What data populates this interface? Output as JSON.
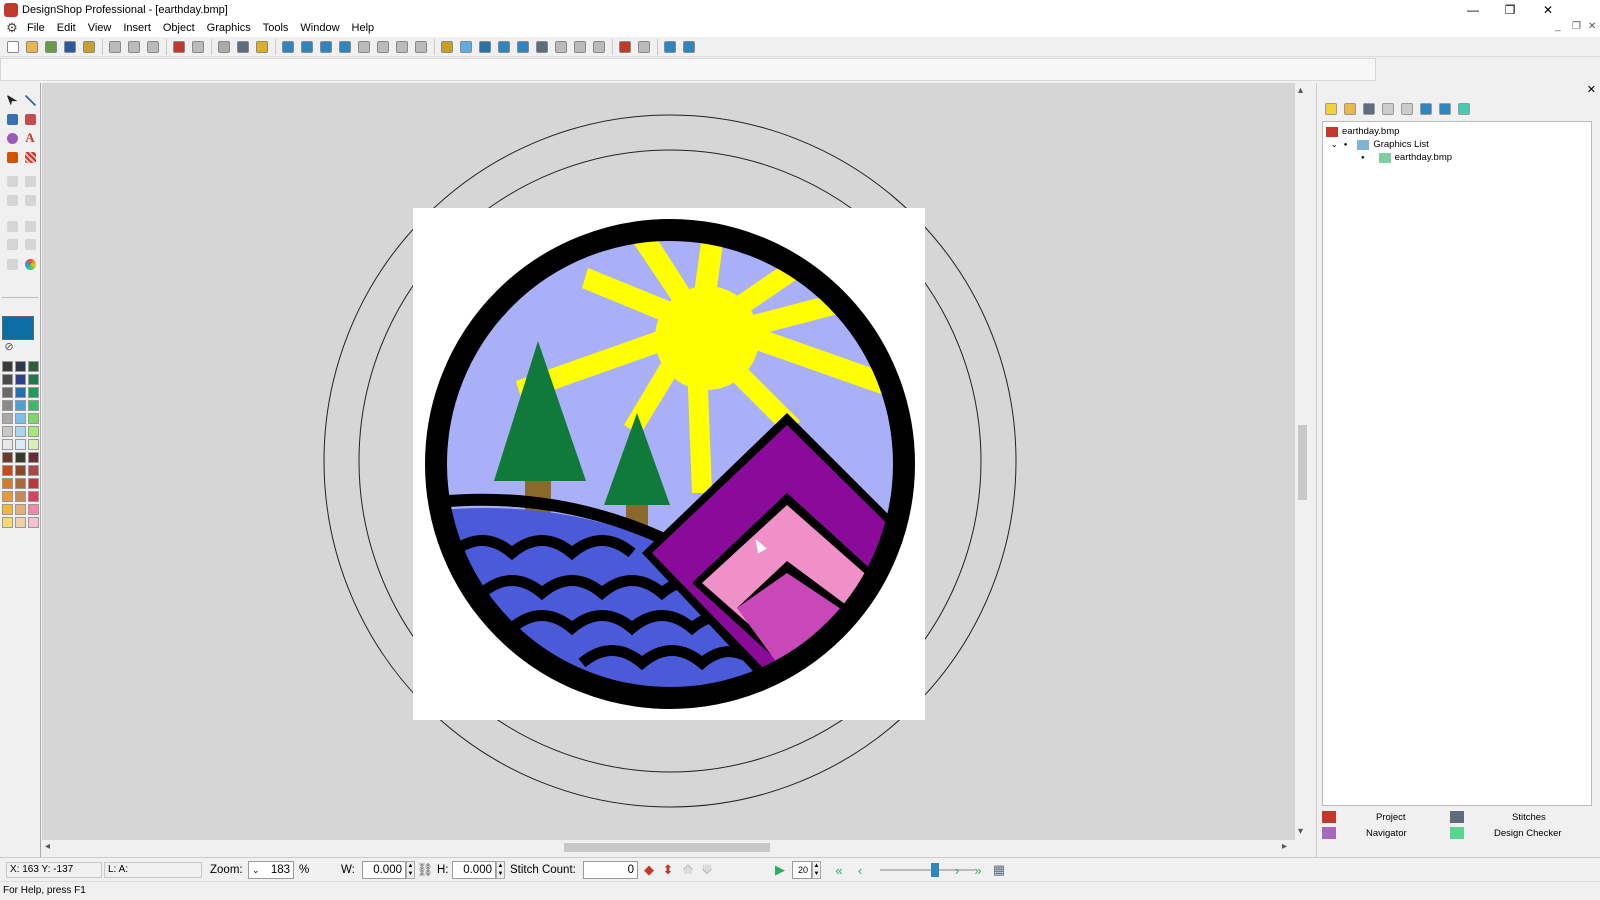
{
  "window": {
    "title": "DesignShop Professional - [earthday.bmp]",
    "minimize": "—",
    "restore": "❐",
    "close": "✕"
  },
  "menu": [
    "File",
    "Edit",
    "View",
    "Insert",
    "Object",
    "Graphics",
    "Tools",
    "Window",
    "Help"
  ],
  "mdi": {
    "minimize": "_",
    "restore": "❐",
    "close": "✕"
  },
  "toolbar_icons": [
    "new-icon",
    "open-icon",
    "import-icon",
    "save-icon",
    "save-as-icon",
    "cut-icon",
    "copy-icon",
    "paste-icon",
    "undo-icon",
    "redo-icon",
    "print-preview-icon",
    "print-icon",
    "help-icon",
    "zoom-fit-icon",
    "zoom-in-icon",
    "zoom-out-icon",
    "zoom-box-icon",
    "zoom-1to1-icon",
    "zoom-page-icon",
    "zoom-all-icon",
    "zoom-prev-icon",
    "measure-icon",
    "grid-icon",
    "hoop-icon",
    "table-icon",
    "view-icon",
    "stitch-view-icon",
    "3d-view-icon",
    "show-icon",
    "hide-icon",
    "stitch-icon",
    "convert-icon",
    "wizard-icon",
    "sequence-icon"
  ],
  "current_color": "#0b6fa6",
  "palette": [
    "#3a3a3a",
    "#2d3a4a",
    "#2f5d3a",
    "#4b4b4b",
    "#2f3d8a",
    "#1e7a4a",
    "#6a6a6a",
    "#1e6fb3",
    "#1f9c5a",
    "#8a8a8a",
    "#4aa0d8",
    "#40b86a",
    "#a8a8a8",
    "#7cc0e8",
    "#7dd86a",
    "#c8c8c8",
    "#a8d8f0",
    "#a8e878",
    "#e8e8e8",
    "#d8ecf8",
    "#d8f0b8",
    "#6a3a2a",
    "#3a3a2a",
    "#6a2a3a",
    "#c84a1a",
    "#8a4a2a",
    "#a84a4a",
    "#d87a2a",
    "#a86a3a",
    "#b83a3a",
    "#e89a3a",
    "#c88a5a",
    "#d8406a",
    "#f0b83a",
    "#e0b07a",
    "#f088a8",
    "#f8d870",
    "#f0d0a8",
    "#f8c0d0"
  ],
  "tree": {
    "root": "earthday.bmp",
    "group": "Graphics List",
    "child": "earthday.bmp"
  },
  "tabs": {
    "project": "Project",
    "stitches": "Stitches",
    "navigator": "Navigator",
    "design_checker": "Design Checker"
  },
  "status": {
    "coords": "X: 163  Y: -137",
    "layer": "L: A:",
    "zoom_label": "Zoom:",
    "zoom_value": "183",
    "zoom_unit": "%",
    "w_label": "W:",
    "w_value": "0.000",
    "h_label": "H:",
    "h_value": "0.000",
    "stitch_count_label": "Stitch Count:",
    "stitch_count_value": "0",
    "speed_value": "20"
  },
  "help_text": "For Help, press F1",
  "artwork": {
    "sky": "#aab0f8",
    "sun": "#ffff00",
    "tree": "#0f7a3a",
    "trunk": "#8a6a2a",
    "water": "#4a5ad8",
    "mountain_outer": "#8a0a9a",
    "mountain_mid": "#f090c8",
    "mountain_inner": "#c848b8",
    "outline": "#000000"
  }
}
